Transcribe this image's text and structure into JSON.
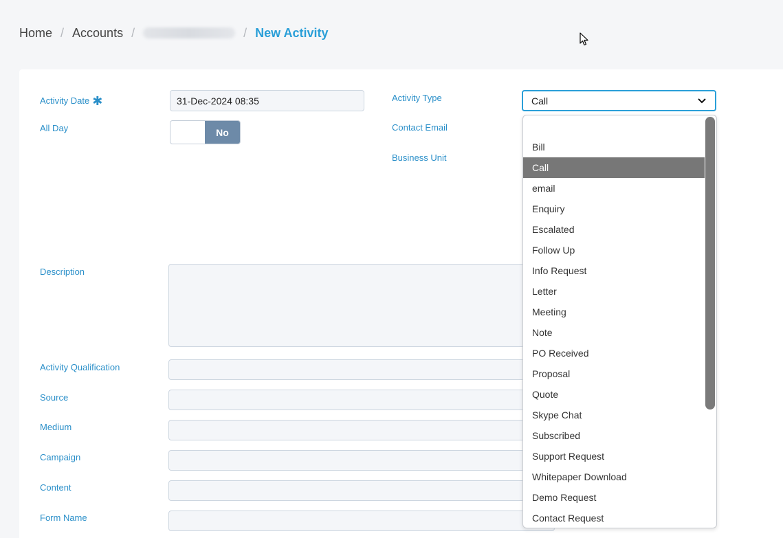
{
  "breadcrumb": {
    "home": "Home",
    "accounts": "Accounts",
    "account_name": "",
    "current": "New Activity",
    "separator": "/"
  },
  "form": {
    "activity_date": {
      "label": "Activity Date",
      "value": "31-Dec-2024 08:35",
      "required_marker": "✱"
    },
    "all_day": {
      "label": "All Day",
      "value": "No"
    },
    "activity_type": {
      "label": "Activity Type",
      "value": "Call"
    },
    "contact_email": {
      "label": "Contact Email"
    },
    "business_unit": {
      "label": "Business Unit"
    },
    "description": {
      "label": "Description"
    },
    "activity_qualification": {
      "label": "Activity Qualification"
    },
    "source": {
      "label": "Source"
    },
    "medium": {
      "label": "Medium"
    },
    "campaign": {
      "label": "Campaign"
    },
    "content": {
      "label": "Content"
    },
    "form_name": {
      "label": "Form Name"
    }
  },
  "dropdown": {
    "options": [
      "",
      "Bill",
      "Call",
      "email",
      "Enquiry",
      "Escalated",
      "Follow Up",
      "Info Request",
      "Letter",
      "Meeting",
      "Note",
      "PO Received",
      "Proposal",
      "Quote",
      "Skype Chat",
      "Subscribed",
      "Support Request",
      "Whitepaper Download",
      "Demo Request",
      "Contact Request"
    ],
    "selected": "Call"
  },
  "colors": {
    "accent": "#2a9fd8",
    "label": "#2a8fc9",
    "toggle": "#6d8aa8",
    "selected_option": "#777777"
  },
  "icons": {
    "select": "chevron-down-icon",
    "pointer": "mouse-pointer-icon"
  }
}
